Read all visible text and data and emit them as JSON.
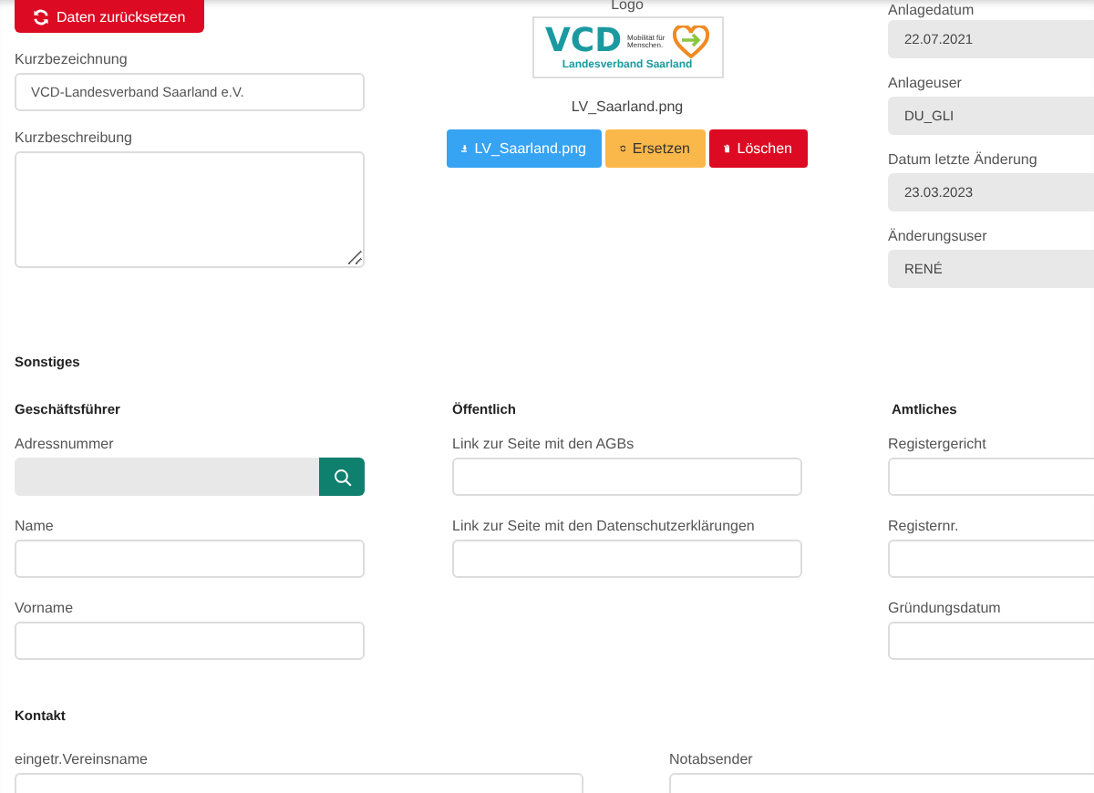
{
  "toolbar": {
    "reset_button": "Daten zurücksetzen"
  },
  "general": [
    {
      "label": "Kurzbezeichnung",
      "value": "VCD-Landesverband Saarland e.V.",
      "kind": "text",
      "disabled": false
    },
    {
      "label": "Kurzbeschreibung",
      "kind": "textarea",
      "disabled": false
    }
  ],
  "logo": {
    "label": "Logo",
    "image": {
      "title": "VCD",
      "tagline": "Mobilität für Menschen.",
      "subtitle": "Landesverband Saarland"
    },
    "filename": "LV_Saarland.png",
    "buttons": [
      {
        "label": "LV_Saarland.png",
        "kind": "download"
      },
      {
        "label": "Ersetzen",
        "kind": "replace"
      },
      {
        "label": "Löschen",
        "kind": "delete"
      }
    ]
  },
  "audit": [
    {
      "label": "Anlagedatum",
      "value": "22.07.2021",
      "kind": "text",
      "disabled": true
    },
    {
      "label": "Anlageuser",
      "value": "DU_GLI",
      "kind": "text",
      "disabled": true
    },
    {
      "label": "Datum letzte Änderung",
      "value": "23.03.2023",
      "kind": "text",
      "disabled": true
    },
    {
      "label": "Änderungsuser",
      "value": "RENÉ",
      "kind": "text",
      "disabled": true
    }
  ],
  "sonstiges": {
    "title": "Sonstiges",
    "groups": [
      {
        "title": "Geschäftsführer",
        "fields": [
          {
            "label": "Adressnummer",
            "kind": "lookup",
            "disabled": true
          },
          {
            "label": "Name",
            "kind": "text",
            "disabled": false
          },
          {
            "label": "Vorname",
            "kind": "text",
            "disabled": false
          }
        ]
      },
      {
        "title": "Öffentlich",
        "fields": [
          {
            "label": "Link zur Seite mit den AGBs",
            "kind": "text",
            "disabled": false
          },
          {
            "label": "Link zur Seite mit den Datenschutzerklärungen",
            "kind": "text",
            "disabled": false
          }
        ]
      },
      {
        "title": "Amtliches",
        "fields": [
          {
            "label": "Registergericht",
            "kind": "text",
            "disabled": false
          },
          {
            "label": "Registernr.",
            "kind": "text",
            "disabled": false
          },
          {
            "label": "Gründungsdatum",
            "kind": "text",
            "disabled": false
          }
        ]
      }
    ]
  },
  "kontakt": {
    "title": "Kontakt",
    "fields": [
      {
        "label": "eingetr.Vereinsname",
        "kind": "text",
        "disabled": false
      },
      {
        "label": "Notabsender",
        "kind": "text",
        "disabled": false
      }
    ]
  }
}
